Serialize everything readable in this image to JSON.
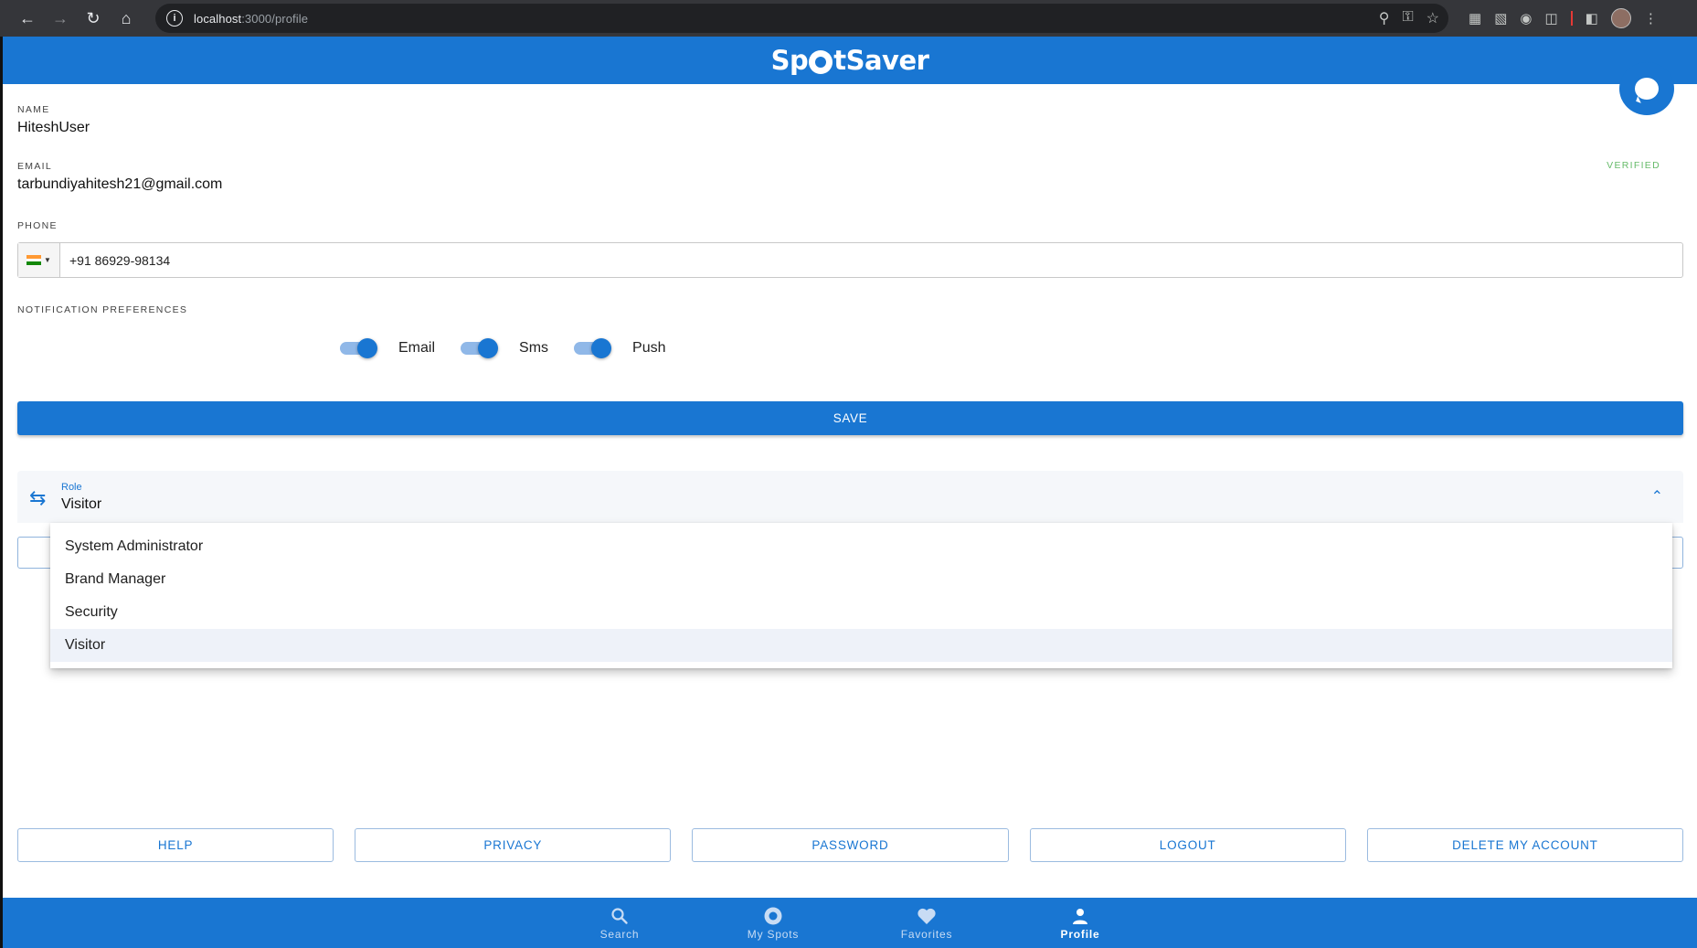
{
  "browser": {
    "url_host": "localhost",
    "url_rest": ":3000/profile"
  },
  "app": {
    "logo_pre": "Sp",
    "logo_post": "tSaver"
  },
  "profile": {
    "name_label": "NAME",
    "name_value": "HiteshUser",
    "email_label": "EMAIL",
    "email_value": "tarbundiyahitesh21@gmail.com",
    "verified_label": "VERIFIED",
    "phone_label": "PHONE",
    "phone_value": "+91 86929-98134",
    "notif_label": "NOTIFICATION PREFERENCES",
    "notif_email": "Email",
    "notif_sms": "Sms",
    "notif_push": "Push",
    "save_label": "SAVE"
  },
  "role": {
    "label": "Role",
    "value": "Visitor",
    "options": [
      "System Administrator",
      "Brand Manager",
      "Security",
      "Visitor"
    ]
  },
  "actions": {
    "help": "HELP",
    "privacy": "PRIVACY",
    "password": "PASSWORD",
    "logout": "LOGOUT",
    "delete": "DELETE MY ACCOUNT"
  },
  "bottom_nav": {
    "search": "Search",
    "my_spots": "My Spots",
    "favorites": "Favorites",
    "profile": "Profile"
  },
  "colors": {
    "primary": "#1976d2",
    "verified": "#66bb6a"
  }
}
